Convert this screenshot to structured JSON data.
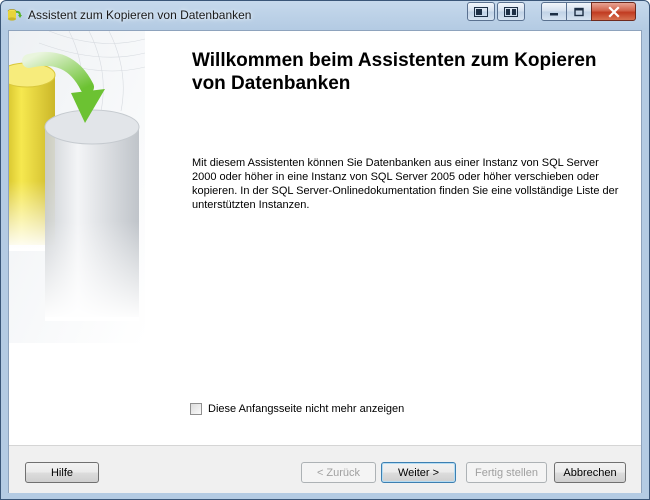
{
  "window": {
    "title": "Assistent zum Kopieren von Datenbanken"
  },
  "titlebar_buttons": {
    "extra1_icon": "window-layout-icon",
    "extra2_icon": "window-tile-icon",
    "minimize_icon": "minimize-icon",
    "maximize_icon": "maximize-icon",
    "close_icon": "close-icon"
  },
  "main": {
    "heading": "Willkommen beim Assistenten zum Kopieren von Datenbanken",
    "description": "Mit diesem Assistenten können Sie Datenbanken aus einer Instanz von SQL Server 2000 oder höher in eine Instanz von SQL Server 2005 oder höher verschieben oder kopieren. In der SQL Server-Onlinedokumentation finden Sie eine vollständige Liste der unterstützten Instanzen.",
    "checkbox_label": "Diese Anfangsseite nicht mehr anzeigen",
    "checkbox_checked": false
  },
  "buttons": {
    "help": "Hilfe",
    "back": "< Zurück",
    "next": "Weiter >",
    "finish": "Fertig stellen",
    "cancel": "Abbrechen"
  },
  "colors": {
    "accent_cylinder": "#e8d84a",
    "arrow": "#7fcf3f"
  }
}
